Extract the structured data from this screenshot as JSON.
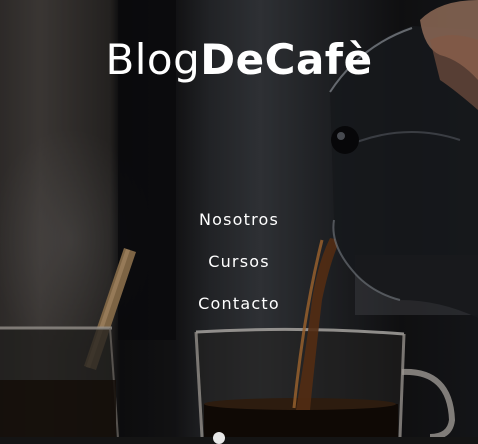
{
  "site": {
    "logo_light": "Blog",
    "logo_bold": "DeCafè"
  },
  "nav": {
    "items": [
      {
        "label": "Nosotros"
      },
      {
        "label": "Cursos"
      },
      {
        "label": "Contacto"
      }
    ]
  },
  "hero": {
    "image": "coffee-pour-photo",
    "overlay_color": "#000000"
  }
}
